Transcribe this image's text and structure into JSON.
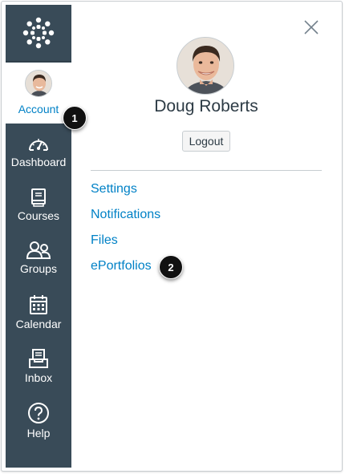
{
  "sidebar": {
    "logo_icon": "canvas-logo-icon",
    "account_label": "Account",
    "items": [
      {
        "label": "Dashboard",
        "icon": "dashboard-gauge-icon"
      },
      {
        "label": "Courses",
        "icon": "book-icon"
      },
      {
        "label": "Groups",
        "icon": "people-icon"
      },
      {
        "label": "Calendar",
        "icon": "calendar-icon"
      },
      {
        "label": "Inbox",
        "icon": "inbox-icon"
      },
      {
        "label": "Help",
        "icon": "question-circle-icon"
      }
    ]
  },
  "tray": {
    "close_icon": "close-icon",
    "user_name": "Doug Roberts",
    "logout_label": "Logout",
    "links": [
      "Settings",
      "Notifications",
      "Files",
      "ePortfolios"
    ]
  },
  "annotations": [
    "1",
    "2"
  ],
  "colors": {
    "sidebar_bg": "#394b58",
    "link": "#0081c6",
    "text": "#2d3b45"
  }
}
